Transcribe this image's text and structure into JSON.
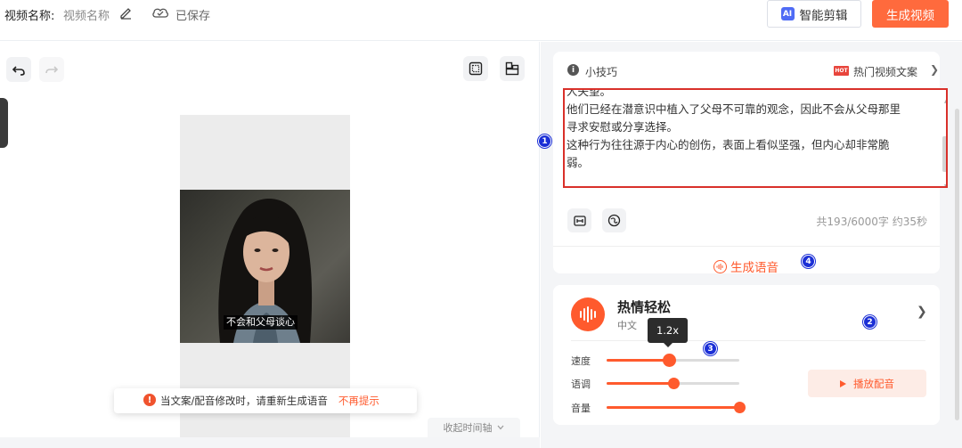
{
  "header": {
    "title_label": "视频名称:",
    "title_value": "视频名称",
    "save_status": "已保存",
    "ai_edit_label": "智能剪辑",
    "ai_badge": "AI",
    "generate_video_label": "生成视频"
  },
  "canvas": {
    "subtitle": "不会和父母谈心",
    "toast_text": "当文案/配音修改时，请重新生成语音",
    "toast_link": "不再提示",
    "toast_icon": "!",
    "timeline_toggle": "收起时间轴"
  },
  "script_panel": {
    "tips_label": "小技巧",
    "hot_badge": "HOT",
    "hot_label": "热门视频文案",
    "lines": [
      "人失望。",
      "他们已经在潜意识中植入了父母不可靠的观念，因此不会从父母那里",
      "寻求安慰或分享选择。",
      "这种行为往往源于内心的创伤，表面上看似坚强，但内心却非常脆",
      "弱。"
    ],
    "count": "共193/6000字 约35秒",
    "generate_voice_label": "生成语音"
  },
  "voice_panel": {
    "name": "热情轻松",
    "lang": "中文",
    "speed_tooltip": "1.2x",
    "sliders": [
      {
        "label": "速度",
        "level": 0.47
      },
      {
        "label": "语调",
        "level": 0.5
      },
      {
        "label": "音量",
        "level": 1.0
      }
    ],
    "play_label": "播放配音"
  },
  "markers": [
    "1",
    "2",
    "3",
    "4"
  ],
  "colors": {
    "accent": "#ff5a2d",
    "highlight_border": "#d9302a",
    "marker": "#1b2fd6"
  }
}
